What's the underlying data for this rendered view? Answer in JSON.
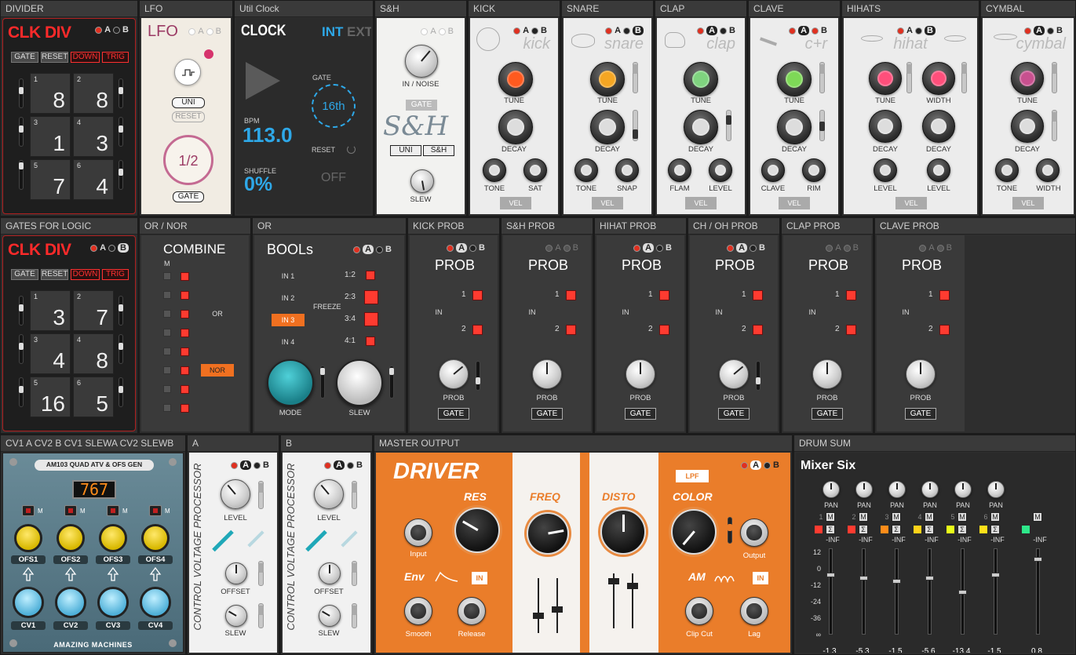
{
  "row1": {
    "divider": {
      "header": "DIVIDER",
      "title": "CLK DIV",
      "ab": [
        "A",
        "B"
      ],
      "buttons": [
        "GATE",
        "RESET",
        "DOWN",
        "TRIG"
      ],
      "pads": [
        {
          "n": "1",
          "v": "8"
        },
        {
          "n": "2",
          "v": "8"
        },
        {
          "n": "3",
          "v": "1"
        },
        {
          "n": "4",
          "v": "3"
        },
        {
          "n": "5",
          "v": "7"
        },
        {
          "n": "6",
          "v": "4"
        }
      ]
    },
    "lfo": {
      "header": "LFO",
      "title": "LFO",
      "ab": [
        "A",
        "B"
      ],
      "uni": "UNI",
      "reset": "RESET",
      "rate": "1/2",
      "gate": "GATE"
    },
    "clock": {
      "header": "Util Clock",
      "title": "CLOCK",
      "int": "INT",
      "ext": "EXT",
      "gate_label": "GATE",
      "gate_value": "16th",
      "bpm_label": "BPM",
      "bpm_value": "113.0",
      "reset_label": "RESET",
      "shuffle_label": "SHUFFLE",
      "shuffle_value": "0%",
      "off": "OFF"
    },
    "sh": {
      "header": "S&H",
      "ab": [
        "A",
        "B"
      ],
      "in_noise": "IN / NOISE",
      "gate": "GATE",
      "title": "S&H",
      "uni": "UNI",
      "sh": "S&H",
      "slew": "SLEW"
    },
    "kick": {
      "header": "KICK",
      "name": "kick",
      "ab": [
        "A",
        "B"
      ],
      "tune": "TUNE",
      "decay": "DECAY",
      "k3": "TONE",
      "k4": "SAT",
      "vel": "VEL",
      "color": "#ff5a1f"
    },
    "snare": {
      "header": "SNARE",
      "name": "snare",
      "ab": [
        "A",
        "B"
      ],
      "tune": "TUNE",
      "decay": "DECAY",
      "k3": "TONE",
      "k4": "SNAP",
      "vel": "VEL",
      "color": "#f5a623"
    },
    "clap": {
      "header": "CLAP",
      "name": "clap",
      "ab": [
        "A",
        "B"
      ],
      "tune": "TUNE",
      "decay": "DECAY",
      "k3": "FLAM",
      "k4": "LEVEL",
      "vel": "VEL",
      "color": "#7fd37f"
    },
    "clave": {
      "header": "CLAVE",
      "name": "c+r",
      "ab": [
        "A",
        "B"
      ],
      "tune": "TUNE",
      "decay": "DECAY",
      "k3": "CLAVE",
      "k4": "RIM",
      "vel": "VEL",
      "color": "#7ed957"
    },
    "hihats": {
      "header": "HIHATS",
      "name": "hihat",
      "ab": [
        "A",
        "B"
      ],
      "tune": "TUNE",
      "width": "WIDTH",
      "decay1": "DECAY",
      "decay2": "DECAY",
      "level1": "LEVEL",
      "level2": "LEVEL",
      "vel": "VEL",
      "color": "#ff4f7b"
    },
    "cymbal": {
      "header": "CYMBAL",
      "name": "cymbal",
      "ab": [
        "A",
        "B"
      ],
      "tune": "TUNE",
      "decay": "DECAY",
      "k3": "TONE",
      "k4": "WIDTH",
      "vel": "VEL",
      "color": "#c8508f"
    }
  },
  "row2": {
    "gates": {
      "header": "GATES FOR LOGIC",
      "title": "CLK DIV",
      "ab": [
        "A",
        "B"
      ],
      "buttons": [
        "GATE",
        "RESET",
        "DOWN",
        "TRIG"
      ],
      "pads": [
        {
          "n": "1",
          "v": "3"
        },
        {
          "n": "2",
          "v": "7"
        },
        {
          "n": "3",
          "v": "4"
        },
        {
          "n": "4",
          "v": "8"
        },
        {
          "n": "5",
          "v": "16"
        },
        {
          "n": "6",
          "v": "5"
        }
      ]
    },
    "ornor": {
      "header": "OR / NOR",
      "title": "COMBINE",
      "m": "M",
      "or": "OR",
      "nor": "NOR"
    },
    "or": {
      "header": "OR",
      "title": "BOOLs",
      "ab": [
        "A",
        "B"
      ],
      "inputs": [
        "IN 1",
        "IN 2",
        "IN 3",
        "IN 4"
      ],
      "ratios": [
        "1:2",
        "2:3",
        "3:4",
        "4:1"
      ],
      "freeze": "FREEZE",
      "mode": "MODE",
      "slew": "SLEW"
    },
    "probs": [
      {
        "header": "KICK PROB",
        "title": "PROB",
        "ab": [
          "A",
          "B"
        ],
        "one": "1",
        "two": "2",
        "in": "IN",
        "knob": "PROB",
        "gate": "GATE"
      },
      {
        "header": "S&H PROB",
        "title": "PROB",
        "ab": [
          "A",
          "B"
        ],
        "one": "1",
        "two": "2",
        "in": "IN",
        "knob": "PROB",
        "gate": "GATE"
      },
      {
        "header": "HIHAT PROB",
        "title": "PROB",
        "ab": [
          "A",
          "B"
        ],
        "one": "1",
        "two": "2",
        "in": "IN",
        "knob": "PROB",
        "gate": "GATE"
      },
      {
        "header": "CH / OH PROB",
        "title": "PROB",
        "ab": [
          "A",
          "B"
        ],
        "one": "1",
        "two": "2",
        "in": "IN",
        "knob": "PROB",
        "gate": "GATE"
      },
      {
        "header": "CLAP PROB",
        "title": "PROB",
        "ab": [
          "A",
          "B"
        ],
        "one": "1",
        "two": "2",
        "in": "IN",
        "knob": "PROB",
        "gate": "GATE"
      },
      {
        "header": "CLAVE PROB",
        "title": "PROB",
        "ab": [
          "A",
          "B"
        ],
        "one": "1",
        "two": "2",
        "in": "IN",
        "knob": "PROB",
        "gate": "GATE"
      }
    ]
  },
  "row3": {
    "atv": {
      "header": "CV1 A CV2 B CV1 SLEWA CV2 SLEWB",
      "title": "AM103 QUAD ATV & OFS GEN",
      "display": "767",
      "m": "M",
      "ofs": [
        "OFS1",
        "OFS2",
        "OFS3",
        "OFS4"
      ],
      "cv": [
        "CV1",
        "CV2",
        "CV3",
        "CV4"
      ],
      "brand": "AMAZING MACHINES"
    },
    "cvpa": {
      "header": "A",
      "side": "CONTROL VOLTAGE PROCESSOR",
      "ab": [
        "A",
        "B"
      ],
      "level": "LEVEL",
      "offset": "OFFSET",
      "slew": "SLEW"
    },
    "cvpb": {
      "header": "B",
      "side": "CONTROL VOLTAGE PROCESSOR",
      "ab": [
        "A",
        "B"
      ],
      "level": "LEVEL",
      "offset": "OFFSET",
      "slew": "SLEW"
    },
    "master": {
      "header": "MASTER OUTPUT",
      "title": "DRIVER",
      "res": "RES",
      "input": "Input",
      "env": "Env",
      "in1": "IN",
      "smooth": "Smooth",
      "release": "Release",
      "freq": "FREQ",
      "disto": "DISTO",
      "color": "COLOR",
      "lpf": "LPF",
      "output": "Output",
      "am": "AM",
      "in2": "IN",
      "clipcut": "Clip Cut",
      "lag": "Lag",
      "ab": [
        "A",
        "B"
      ]
    },
    "drum": {
      "header": "DRUM SUM",
      "title": "Mixer Six",
      "pan": "PAN",
      "m": "M",
      "s": "Σ",
      "inf": "-INF",
      "channels": [
        "1",
        "2",
        "3",
        "4",
        "5",
        "6"
      ],
      "colors": [
        "#ff3b30",
        "#ff3b30",
        "#ff8c1a",
        "#ffd21a",
        "#e8ff1a",
        "#ffe01a",
        "#2ee88a"
      ],
      "scale": [
        "12",
        "0",
        "-12",
        "-24",
        "-36",
        "∞"
      ],
      "values": [
        "-1.3",
        "-5.3",
        "-1.5",
        "-5.6",
        "-13.4",
        "-1.5",
        "0.8"
      ]
    }
  }
}
